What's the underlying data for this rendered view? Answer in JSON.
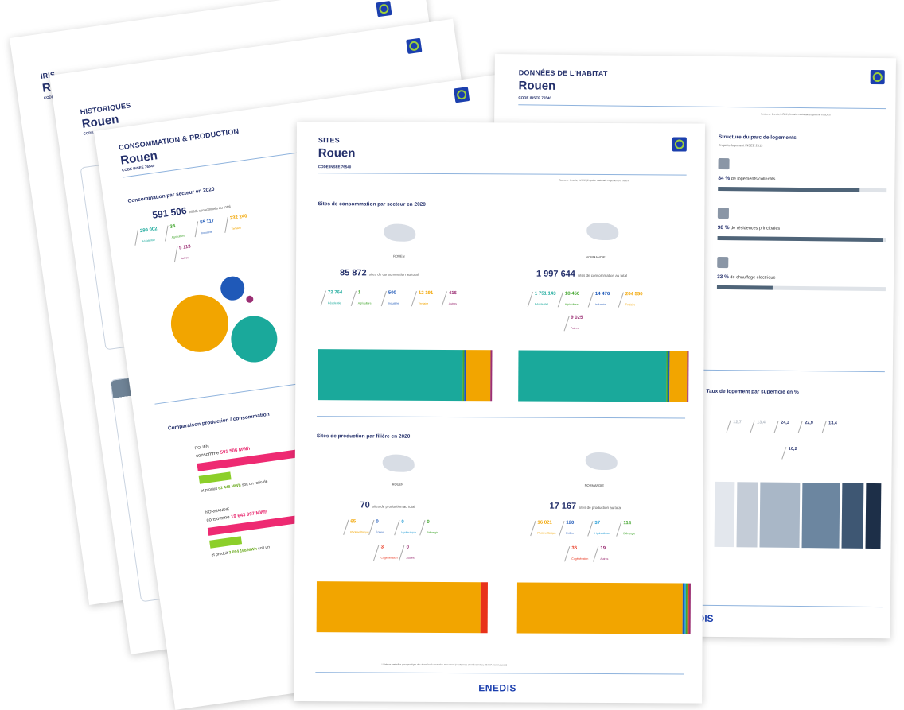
{
  "sheets": {
    "iris": {
      "kicker": "IRIS",
      "city": "Rouen",
      "code": "CODE"
    },
    "historiques": {
      "kicker": "HISTORIQUES",
      "city": "Rouen",
      "code": "CODE"
    },
    "conso": {
      "kicker": "CONSOMMATION & PRODUCTION",
      "city": "Rouen",
      "code": "CODE INSEE 76540",
      "sector_title": "Consommation par secteur en 2020",
      "total": "591 506",
      "total_suffix": "MWh consommés au total",
      "sectors": [
        {
          "value": "299 002",
          "label": "Résidentiel",
          "color": "#1aa99b"
        },
        {
          "value": "34",
          "label": "Agriculture",
          "color": "#43a62f"
        },
        {
          "value": "55 117",
          "label": "Industrie",
          "color": "#1f59b8"
        },
        {
          "value": "232 240",
          "label": "Tertiaire",
          "color": "#f2a500"
        },
        {
          "value": "5 113",
          "label": "Autres",
          "color": "#9b2f74"
        }
      ],
      "compare_title": "Comparaison production / consommation",
      "rouen_label": "ROUEN",
      "rouen_consumes": "consomme",
      "rouen_conso_value": "591 506 MWh",
      "rouen_prod_prefix": "et produit",
      "rouen_prod_value": "62 448 MWh",
      "rouen_prod_suffix": "soit un ratio de",
      "norm_label": "NORMANDIE",
      "norm_consumes": "consomme",
      "norm_conso_value": "19 643 997 MWh",
      "norm_prod_prefix": "et produit",
      "norm_prod_value": "3 094 168 MWh",
      "norm_prod_suffix": "soit un"
    },
    "sites": {
      "kicker": "SITES",
      "city": "Rouen",
      "code": "CODE INSEE 76540",
      "source": "Sources : Enedis, INSEE (Enquête Nationale Logement) et SDES",
      "cons_title": "Sites de consommation par secteur en 2020",
      "left_map_label": "ROUEN",
      "right_map_label": "NORMANDIE",
      "left_total": "85 872",
      "left_total_suffix": "sites de consommation au total",
      "right_total": "1 997 644",
      "right_total_suffix": "sites de consommation au total",
      "left_cons": [
        {
          "value": "72 764",
          "label": "Résidentiel",
          "color": "#1aa99b"
        },
        {
          "value": "1",
          "label": "Agriculture",
          "color": "#43a62f"
        },
        {
          "value": "500",
          "label": "Industrie",
          "color": "#1f59b8"
        },
        {
          "value": "12 191",
          "label": "Tertiaire",
          "color": "#f2a500"
        },
        {
          "value": "416",
          "label": "Autres",
          "color": "#9b2f74"
        }
      ],
      "right_cons": [
        {
          "value": "1 751 143",
          "label": "Résidentiel",
          "color": "#1aa99b"
        },
        {
          "value": "18 450",
          "label": "Agriculture",
          "color": "#43a62f"
        },
        {
          "value": "14 476",
          "label": "Industrie",
          "color": "#1f59b8"
        },
        {
          "value": "204 550",
          "label": "Tertiaire",
          "color": "#f2a500"
        },
        {
          "value": "9 025",
          "label": "Autres",
          "color": "#9b2f74"
        }
      ],
      "prod_title": "Sites de production par filière en 2020",
      "left_prod_total": "70",
      "left_prod_total_suffix": "sites de production au total",
      "right_prod_total": "17 167",
      "right_prod_total_suffix": "sites de production au total",
      "left_prod": [
        {
          "value": "65",
          "label": "Photovoltaïque",
          "color": "#f2a500"
        },
        {
          "value": "0",
          "label": "Éolien",
          "color": "#1f59b8"
        },
        {
          "value": "0",
          "label": "Hydraulique",
          "color": "#2a9fd6"
        },
        {
          "value": "0",
          "label": "Biénergie",
          "color": "#43a62f"
        },
        {
          "value": "3",
          "label": "Cogénération",
          "color": "#e8321a"
        },
        {
          "value": "0",
          "label": "Autres",
          "color": "#9b2f74"
        }
      ],
      "right_prod": [
        {
          "value": "16 821",
          "label": "Photovoltaïque",
          "color": "#f2a500"
        },
        {
          "value": "120",
          "label": "Éolien",
          "color": "#1f59b8"
        },
        {
          "value": "37",
          "label": "Hydraulique",
          "color": "#2a9fd6"
        },
        {
          "value": "114",
          "label": "Biénergie",
          "color": "#43a62f"
        },
        {
          "value": "36",
          "label": "Cogénération",
          "color": "#e8321a"
        },
        {
          "value": "19",
          "label": "Autres",
          "color": "#9b2f74"
        }
      ],
      "footnote": "* Valeurs partielles pour protéger des données à caractère Personnel (conformes données RT ou 36 kVA non incluses)",
      "footer_logo": "ENEDIS"
    },
    "habitat": {
      "kicker": "DONNÉES DE L'HABITAT",
      "city": "Rouen",
      "code": "CODE INSEE 76540",
      "source": "Sources : Enedis, INSEE (Enquête Nationale Logement) et SDES",
      "structure_title": "Structure du parc de logements",
      "structure_sub": "Enquête logement INSEE 2013",
      "stats": [
        {
          "value": "84 %",
          "label": "de logements collectifs",
          "pct": 84
        },
        {
          "value": "98 %",
          "label": "de résidences principales",
          "pct": 98
        },
        {
          "value": "33 %",
          "label": "de chauffage électrique",
          "pct": 33
        }
      ],
      "surface_title": "Taux de logement par superficie en %",
      "surface": [
        {
          "value": "12,7",
          "pct": 12.7,
          "color": "#e3e7ed"
        },
        {
          "value": "13,4",
          "pct": 13.4,
          "color": "#c4ccd7"
        },
        {
          "value": "24,3",
          "pct": 24.3,
          "color": "#a9b7c7"
        },
        {
          "value": "22,9",
          "pct": 22.9,
          "color": "#6c86a0"
        },
        {
          "value": "13,4",
          "pct": 13.4,
          "color": "#3e5773"
        },
        {
          "value": "10,2",
          "pct": 10.2,
          "color": "#1d2f48"
        }
      ],
      "footer_logo": "DIS"
    }
  }
}
